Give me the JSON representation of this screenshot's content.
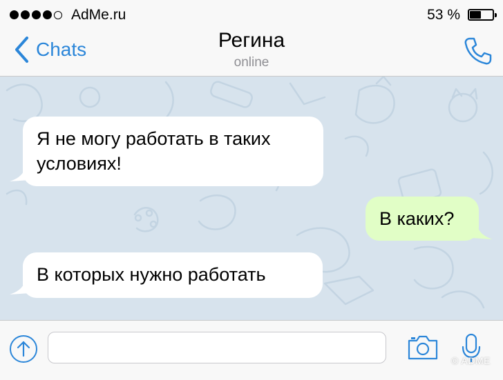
{
  "status_bar": {
    "signal_icon": "signal-dots-icon",
    "carrier": "AdMe.ru",
    "battery_percent": "53 %",
    "battery_level": 0.53
  },
  "nav": {
    "back_label": "Chats",
    "title": "Регина",
    "subtitle": "online",
    "call_icon": "phone-icon"
  },
  "messages": [
    {
      "direction": "incoming",
      "lines": [
        "Я не могу работать в таких",
        "условиях!"
      ]
    },
    {
      "direction": "outgoing",
      "lines": [
        "В каких?"
      ]
    },
    {
      "direction": "incoming",
      "lines": [
        "В которых нужно работать"
      ]
    }
  ],
  "input_bar": {
    "attach_icon": "attach-arrow-up-icon",
    "message_value": "",
    "camera_icon": "camera-icon",
    "mic_icon": "microphone-icon"
  },
  "watermark": "© ADME",
  "colors": {
    "accent": "#2b86d9",
    "chat_background": "#d7e3ed",
    "incoming_bubble": "#ffffff",
    "outgoing_bubble": "#e1fec6"
  }
}
